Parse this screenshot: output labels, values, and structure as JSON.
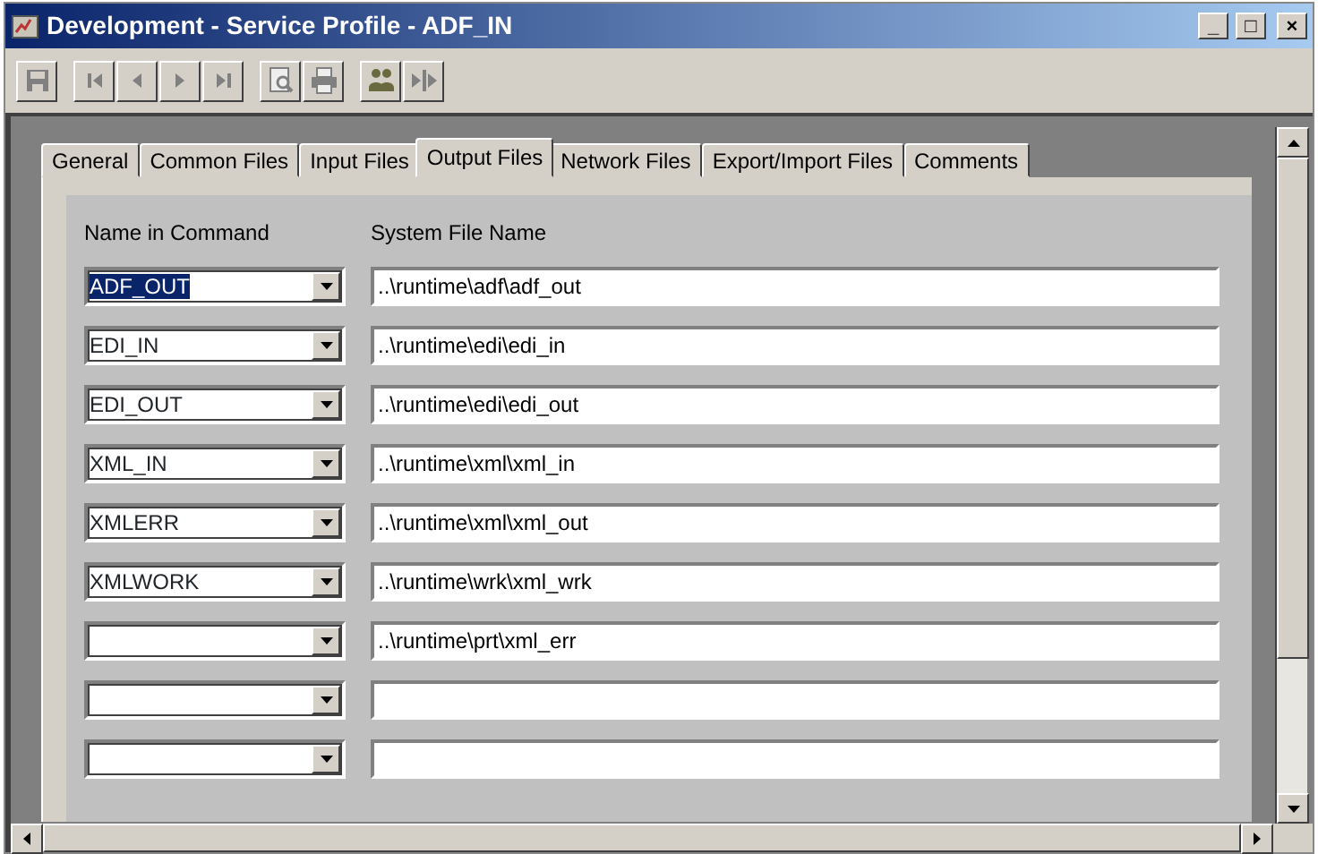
{
  "window": {
    "title": "Development - Service Profile - ADF_IN",
    "controls": [
      "_",
      "□",
      "×"
    ]
  },
  "toolbar": [
    {
      "kind": "save"
    },
    {
      "kind": "first"
    },
    {
      "kind": "prev"
    },
    {
      "kind": "next"
    },
    {
      "kind": "last"
    },
    {
      "kind": "preview"
    },
    {
      "kind": "print"
    },
    {
      "kind": "people"
    },
    {
      "kind": "split"
    }
  ],
  "tabs": [
    {
      "label": "General",
      "selected": false
    },
    {
      "label": "Common Files",
      "selected": false
    },
    {
      "label": "Input Files",
      "selected": false
    },
    {
      "label": "Output Files",
      "selected": true
    },
    {
      "label": "Network Files",
      "selected": false
    },
    {
      "label": "Export/Import Files",
      "selected": false
    },
    {
      "label": "Comments",
      "selected": false
    }
  ],
  "columns": [
    "Name in Command",
    "System File Name"
  ],
  "rows": [
    {
      "name": "ADF_OUT",
      "highlighted": true,
      "file": "..\\runtime\\adf\\adf_out"
    },
    {
      "name": "EDI_IN",
      "highlighted": false,
      "file": "..\\runtime\\edi\\edi_in"
    },
    {
      "name": "EDI_OUT",
      "highlighted": false,
      "file": "..\\runtime\\edi\\edi_out"
    },
    {
      "name": "XML_IN",
      "highlighted": false,
      "file": "..\\runtime\\xml\\xml_in"
    },
    {
      "name": "XMLERR",
      "highlighted": false,
      "file": "..\\runtime\\xml\\xml_out"
    },
    {
      "name": "XMLWORK",
      "highlighted": false,
      "file": "..\\runtime\\wrk\\xml_wrk"
    },
    {
      "name": "",
      "highlighted": false,
      "file": "..\\runtime\\prt\\xml_err"
    },
    {
      "name": "",
      "highlighted": false,
      "file": ""
    },
    {
      "name": "",
      "highlighted": false,
      "file": ""
    }
  ]
}
